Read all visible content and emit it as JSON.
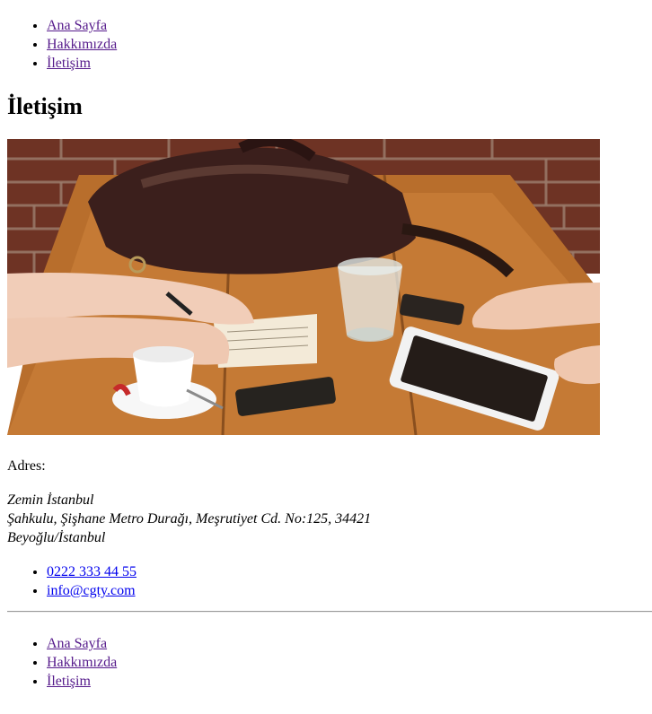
{
  "header_nav": [
    {
      "label": "Ana Sayfa"
    },
    {
      "label": "Hakkımızda"
    },
    {
      "label": "İletişim"
    }
  ],
  "page_title": "İletişim",
  "address": {
    "label": "Adres:",
    "line1": "Zemin İstanbul",
    "line2": "Şahkulu, Şişhane Metro Durağı, Meşrutiyet Cd. No:125, 34421",
    "line3": "Beyoğlu/İstanbul"
  },
  "contact": {
    "phone": "0222 333 44 55",
    "email": "info@cgty.com"
  },
  "footer_nav": [
    {
      "label": "Ana Sayfa"
    },
    {
      "label": "Hakkımızda"
    },
    {
      "label": "İletişim"
    }
  ],
  "colors": {
    "visited_link": "#551a8b",
    "link": "#0000ee"
  }
}
